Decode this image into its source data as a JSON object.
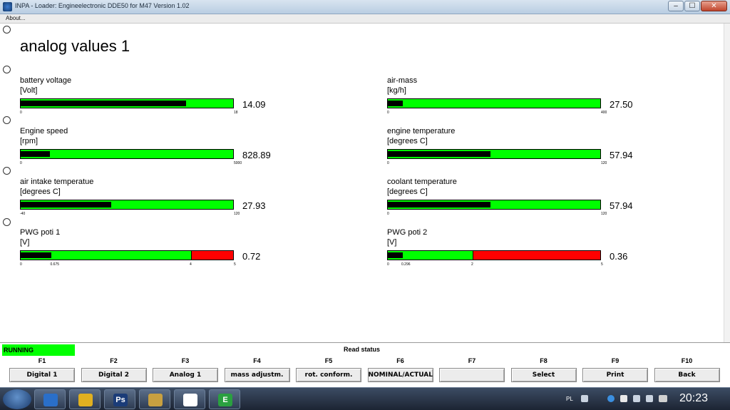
{
  "window": {
    "title": "INPA - Loader:  Engineelectronic DDE50 for M47 Version 1.02",
    "min_glyph": "–",
    "max_glyph": "☐",
    "close_glyph": "✕"
  },
  "menu": {
    "about": "About..."
  },
  "page_title": "analog values 1",
  "gauges": [
    {
      "label": "battery voltage",
      "unit": "[Volt]",
      "min": "0",
      "max": "18",
      "value": "14.09",
      "fill": 0.78,
      "red_from": null,
      "mid_tick": null
    },
    {
      "label": "air-mass",
      "unit": "[kg/h]",
      "min": "0",
      "max": "400",
      "value": "27.50",
      "fill": 0.069,
      "red_from": null,
      "mid_tick": null
    },
    {
      "label": "Engine speed",
      "unit": "[rpm]",
      "min": "0",
      "max": "5000",
      "value": "828.89",
      "fill": 0.136,
      "red_from": null,
      "mid_tick": null
    },
    {
      "label": "engine temperature",
      "unit": "[degrees C]",
      "min": "0",
      "max": "120",
      "value": "57.94",
      "fill": 0.483,
      "red_from": null,
      "mid_tick": null
    },
    {
      "label": "air intake temperatue",
      "unit": "[degrees C]",
      "min": "-40",
      "max": "120",
      "value": "27.93",
      "fill": 0.425,
      "red_from": null,
      "mid_tick": null
    },
    {
      "label": "coolant temperature",
      "unit": "[degrees C]",
      "min": "0",
      "max": "120",
      "value": "57.94",
      "fill": 0.483,
      "red_from": null,
      "mid_tick": null
    },
    {
      "label": "PWG poti 1",
      "unit": "[V]",
      "min": "0",
      "max": "5",
      "value": "0.72",
      "fill": 0.144,
      "red_from": 0.8,
      "mid_tick": "0.675",
      "mid_frac": 0.135,
      "red_tick": "4"
    },
    {
      "label": "PWG poti 2",
      "unit": "[V]",
      "min": "0",
      "max": "5",
      "value": "0.36",
      "fill": 0.072,
      "red_from": 0.4,
      "mid_tick": "0.296",
      "mid_frac": 0.06,
      "red_tick": "2"
    }
  ],
  "status": {
    "running": "RUNNING",
    "read_status": "Read status"
  },
  "fkeys": [
    {
      "key": "F1",
      "label": "Digital 1"
    },
    {
      "key": "F2",
      "label": "Digital 2"
    },
    {
      "key": "F3",
      "label": "Analog 1"
    },
    {
      "key": "F4",
      "label": "mass adjustm."
    },
    {
      "key": "F5",
      "label": "rot. conform."
    },
    {
      "key": "F6",
      "label": "NOMINAL/ACTUAL"
    },
    {
      "key": "F7",
      "label": ""
    },
    {
      "key": "F8",
      "label": "Select"
    },
    {
      "key": "F9",
      "label": "Print"
    },
    {
      "key": "F10",
      "label": "Back"
    }
  ],
  "taskbar": {
    "apps": [
      {
        "name": "explorer-app-icon",
        "color": "#2a6fc9"
      },
      {
        "name": "chrome-app-icon",
        "color": "#e0b020"
      },
      {
        "name": "photoshop-app-icon",
        "color": "#1b3c78",
        "text": "Ps"
      },
      {
        "name": "tools-app-icon",
        "color": "#c8a040"
      },
      {
        "name": "bmw-app-icon",
        "color": "#ffffff"
      },
      {
        "name": "ediabas-app-icon",
        "color": "#2aa040",
        "text": "E"
      }
    ],
    "lang": "PL",
    "clock": "20:23"
  },
  "colors": {
    "green": "#00ff00",
    "red": "#ff0000",
    "black": "#000000"
  }
}
